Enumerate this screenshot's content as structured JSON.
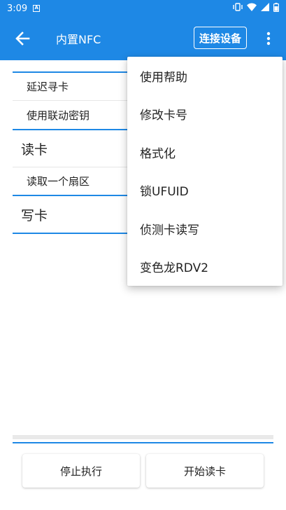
{
  "status_bar": {
    "time": "3:09",
    "notification_icon": "a-notification-icon",
    "icons": [
      "vibrate-icon",
      "wifi-icon",
      "signal-icon",
      "battery-icon"
    ]
  },
  "app_bar": {
    "title": "内置NFC",
    "connect_label": "连接设备",
    "back_icon": "arrow-left-icon",
    "more_icon": "more-vert-icon"
  },
  "content": {
    "group1": [
      {
        "label": "延迟寻卡"
      },
      {
        "label": "使用联动密钥"
      }
    ],
    "read_section": {
      "title": "读卡",
      "items": [
        {
          "label": "读取一个扇区"
        }
      ]
    },
    "write_section": {
      "title": "写卡"
    }
  },
  "bottom": {
    "stop_label": "停止执行",
    "start_label": "开始读卡"
  },
  "menu": {
    "items": [
      {
        "label": "使用帮助"
      },
      {
        "label": "修改卡号"
      },
      {
        "label": "格式化"
      },
      {
        "label": "锁UFUID"
      },
      {
        "label": "侦测卡读写"
      },
      {
        "label": "变色龙RDV2"
      }
    ]
  },
  "colors": {
    "primary": "#1e88e5",
    "background": "#ffffff"
  }
}
